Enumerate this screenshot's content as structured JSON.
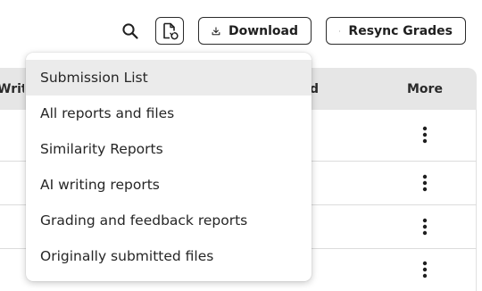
{
  "toolbar": {
    "search_icon": "search-icon",
    "export_icon": "file-export-icon",
    "download_label": "Download",
    "download_icon": "download-icon",
    "resync_label": "Resync Grades",
    "resync_icon": "send-icon"
  },
  "table": {
    "columns": {
      "writing": "Writi",
      "submitted": "d",
      "more": "More"
    },
    "row_action_icon": "more-vertical-icon"
  },
  "menu": {
    "items": [
      {
        "label": "Submission List",
        "active": true
      },
      {
        "label": "All reports and files"
      },
      {
        "label": "Similarity Reports"
      },
      {
        "label": "AI writing reports"
      },
      {
        "label": "Grading and feedback reports"
      },
      {
        "label": "Originally submitted files"
      }
    ]
  },
  "colors": {
    "header_bg": "#e6e6e6",
    "menu_active_bg": "#ebebeb",
    "border": "#2b2b2b"
  }
}
